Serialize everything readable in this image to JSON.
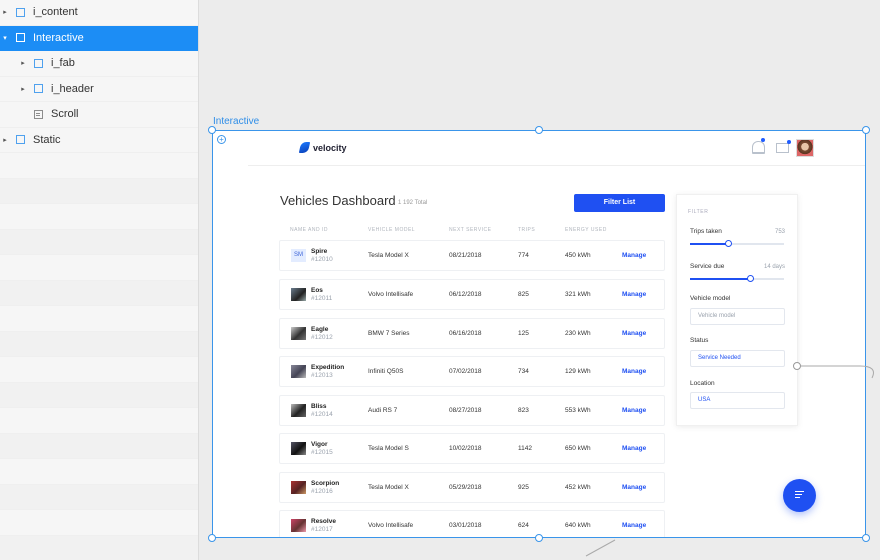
{
  "layers": {
    "items": [
      {
        "label": "i_content",
        "indent": 0,
        "arrow": "▸",
        "icon": "group",
        "selected": false
      },
      {
        "label": "Interactive",
        "indent": 0,
        "arrow": "▾",
        "icon": "group",
        "selected": true
      },
      {
        "label": "i_fab",
        "indent": 1,
        "arrow": "▸",
        "icon": "group",
        "selected": false
      },
      {
        "label": "i_header",
        "indent": 1,
        "arrow": "▸",
        "icon": "group",
        "selected": false
      },
      {
        "label": "Scroll",
        "indent": 1,
        "arrow": "",
        "icon": "text",
        "selected": false
      },
      {
        "label": "Static",
        "indent": 0,
        "arrow": "▸",
        "icon": "group",
        "selected": false
      }
    ]
  },
  "artboard": {
    "label": "Interactive"
  },
  "header": {
    "logo": "velocity"
  },
  "dashboard": {
    "title": "Vehicles Dashboard",
    "total": "1 192 Total",
    "filter_button": "Filter List",
    "columns": [
      "NAME AND ID",
      "VEHICLE MODEL",
      "NEXT SERVICE",
      "TRIPS",
      "ENERGY USED"
    ],
    "manage_label": "Manage",
    "rows": [
      {
        "name": "Spire",
        "id": "#12010",
        "model": "Tesla Model X",
        "service": "08/21/2018",
        "trips": "774",
        "energy": "450 kWh",
        "initials": "SM"
      },
      {
        "name": "Eos",
        "id": "#12011",
        "model": "Volvo Intellisafe",
        "service": "06/12/2018",
        "trips": "825",
        "energy": "321 kWh"
      },
      {
        "name": "Eagle",
        "id": "#12012",
        "model": "BMW 7 Series",
        "service": "06/16/2018",
        "trips": "125",
        "energy": "230 kWh"
      },
      {
        "name": "Expedition",
        "id": "#12013",
        "model": "Infiniti Q50S",
        "service": "07/02/2018",
        "trips": "734",
        "energy": "129 kWh"
      },
      {
        "name": "Bliss",
        "id": "#12014",
        "model": "Audi RS 7",
        "service": "08/27/2018",
        "trips": "823",
        "energy": "553 kWh"
      },
      {
        "name": "Vigor",
        "id": "#12015",
        "model": "Tesla Model S",
        "service": "10/02/2018",
        "trips": "1142",
        "energy": "650 kWh"
      },
      {
        "name": "Scorpion",
        "id": "#12016",
        "model": "Tesla Model X",
        "service": "05/29/2018",
        "trips": "925",
        "energy": "452 kWh"
      },
      {
        "name": "Resolve",
        "id": "#12017",
        "model": "Volvo Intellisafe",
        "service": "03/01/2018",
        "trips": "624",
        "energy": "640 kWh"
      }
    ]
  },
  "filter": {
    "title": "FILTER",
    "trips_label": "Trips taken",
    "trips_value": "753",
    "trips_level": 0.41,
    "service_label": "Service due",
    "service_value": "14 days",
    "service_level": 0.65,
    "model_label": "Vehicle model",
    "model_placeholder": "Vehicle model",
    "status_label": "Status",
    "status_value": "Service Needed",
    "location_label": "Location",
    "location_value": "USA"
  },
  "colors": {
    "accent": "#1f50f2",
    "selection": "#1c8df5"
  }
}
